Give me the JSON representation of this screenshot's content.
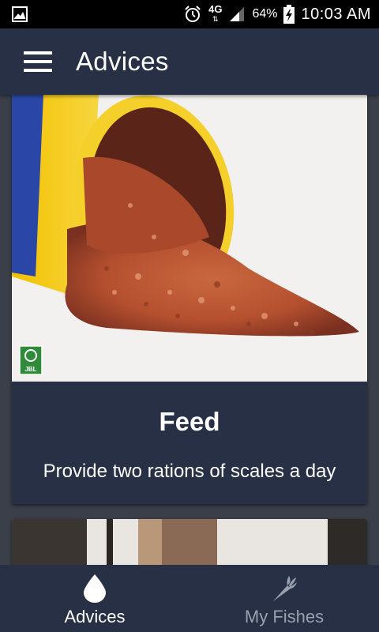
{
  "status_bar": {
    "network": "4G",
    "battery": "64%",
    "time": "10:03 AM"
  },
  "app_bar": {
    "title": "Advices"
  },
  "cards": [
    {
      "title": "Feed",
      "description": "Provide two rations of scales a day",
      "image_logo_text": "JBL"
    }
  ],
  "bottom_nav": {
    "items": [
      {
        "label": "Advices",
        "icon": "drop-icon",
        "active": true
      },
      {
        "label": "My Fishes",
        "icon": "carrot-icon",
        "active": false
      }
    ]
  },
  "colors": {
    "primary": "#283046",
    "background": "#3a3f4a",
    "inactive_text": "#9aa0ad"
  }
}
